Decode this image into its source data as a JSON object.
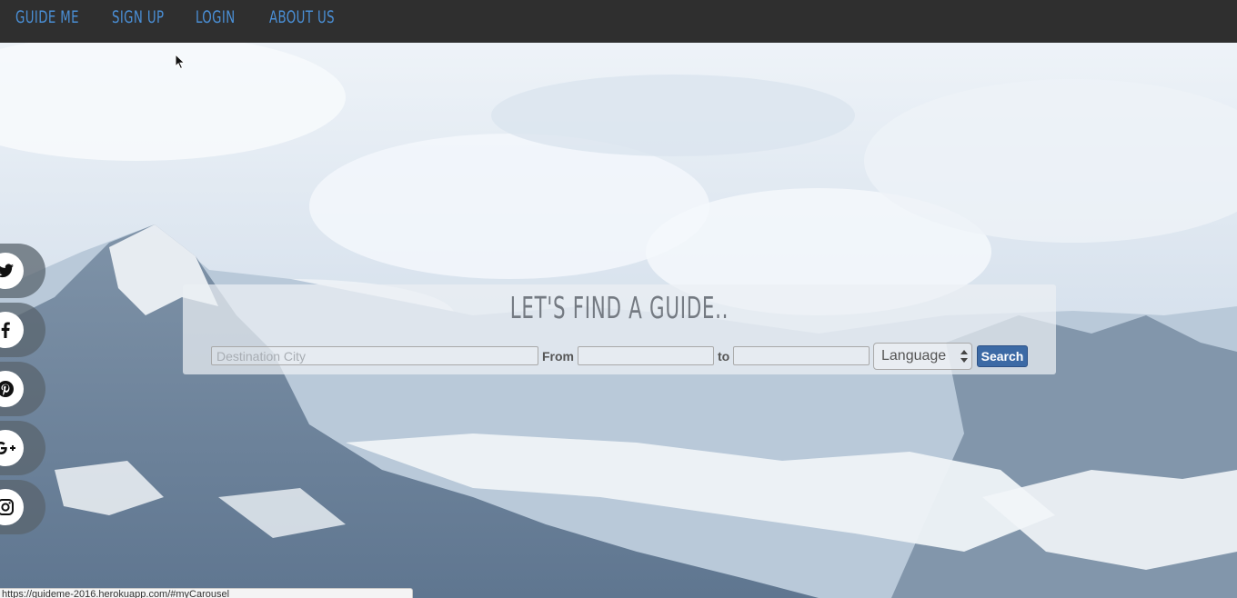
{
  "navbar": {
    "brand": "Guide Me",
    "links": [
      "Sign Up",
      "Login",
      "About Us"
    ]
  },
  "social": {
    "icons": [
      "twitter-icon",
      "facebook-icon",
      "pinterest-icon",
      "google-plus-icon",
      "instagram-icon"
    ]
  },
  "search": {
    "title": "LET'S FIND A GUIDE..",
    "destination_placeholder": "Destination City",
    "destination_value": "",
    "from_label": "From",
    "from_value": "",
    "to_label": "to",
    "to_value": "",
    "language_selected": "Language",
    "search_button": "Search"
  },
  "status_bar": {
    "url": "https://guideme-2016.herokuapp.com/#myCarousel"
  },
  "colors": {
    "navbar_bg": "#2f2f2f",
    "nav_link": "#4a8fd6",
    "search_button": "#3c6aa5"
  }
}
